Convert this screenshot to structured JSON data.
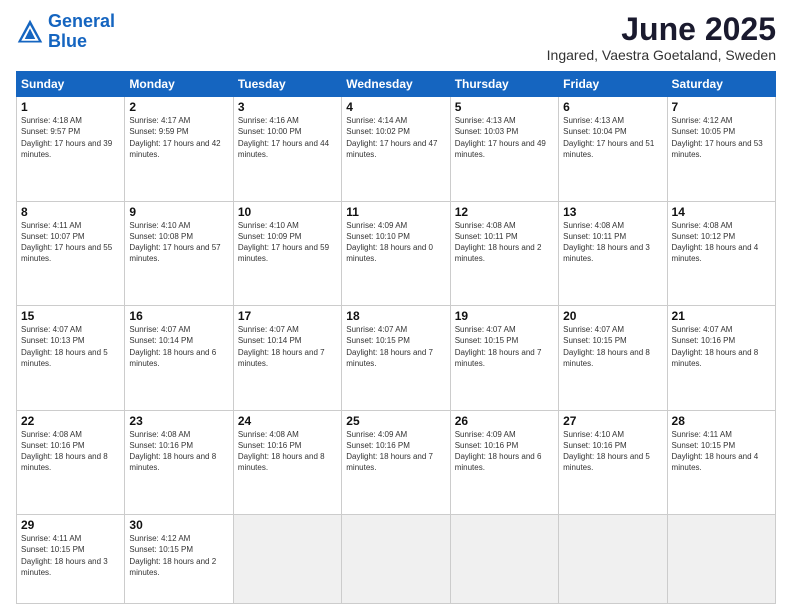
{
  "logo": {
    "line1": "General",
    "line2": "Blue"
  },
  "title": "June 2025",
  "subtitle": "Ingared, Vaestra Goetaland, Sweden",
  "weekdays": [
    "Sunday",
    "Monday",
    "Tuesday",
    "Wednesday",
    "Thursday",
    "Friday",
    "Saturday"
  ],
  "weeks": [
    [
      {
        "day": "1",
        "sunrise": "4:18 AM",
        "sunset": "9:57 PM",
        "daylight": "17 hours and 39 minutes."
      },
      {
        "day": "2",
        "sunrise": "4:17 AM",
        "sunset": "9:59 PM",
        "daylight": "17 hours and 42 minutes."
      },
      {
        "day": "3",
        "sunrise": "4:16 AM",
        "sunset": "10:00 PM",
        "daylight": "17 hours and 44 minutes."
      },
      {
        "day": "4",
        "sunrise": "4:14 AM",
        "sunset": "10:02 PM",
        "daylight": "17 hours and 47 minutes."
      },
      {
        "day": "5",
        "sunrise": "4:13 AM",
        "sunset": "10:03 PM",
        "daylight": "17 hours and 49 minutes."
      },
      {
        "day": "6",
        "sunrise": "4:13 AM",
        "sunset": "10:04 PM",
        "daylight": "17 hours and 51 minutes."
      },
      {
        "day": "7",
        "sunrise": "4:12 AM",
        "sunset": "10:05 PM",
        "daylight": "17 hours and 53 minutes."
      }
    ],
    [
      {
        "day": "8",
        "sunrise": "4:11 AM",
        "sunset": "10:07 PM",
        "daylight": "17 hours and 55 minutes."
      },
      {
        "day": "9",
        "sunrise": "4:10 AM",
        "sunset": "10:08 PM",
        "daylight": "17 hours and 57 minutes."
      },
      {
        "day": "10",
        "sunrise": "4:10 AM",
        "sunset": "10:09 PM",
        "daylight": "17 hours and 59 minutes."
      },
      {
        "day": "11",
        "sunrise": "4:09 AM",
        "sunset": "10:10 PM",
        "daylight": "18 hours and 0 minutes."
      },
      {
        "day": "12",
        "sunrise": "4:08 AM",
        "sunset": "10:11 PM",
        "daylight": "18 hours and 2 minutes."
      },
      {
        "day": "13",
        "sunrise": "4:08 AM",
        "sunset": "10:11 PM",
        "daylight": "18 hours and 3 minutes."
      },
      {
        "day": "14",
        "sunrise": "4:08 AM",
        "sunset": "10:12 PM",
        "daylight": "18 hours and 4 minutes."
      }
    ],
    [
      {
        "day": "15",
        "sunrise": "4:07 AM",
        "sunset": "10:13 PM",
        "daylight": "18 hours and 5 minutes."
      },
      {
        "day": "16",
        "sunrise": "4:07 AM",
        "sunset": "10:14 PM",
        "daylight": "18 hours and 6 minutes."
      },
      {
        "day": "17",
        "sunrise": "4:07 AM",
        "sunset": "10:14 PM",
        "daylight": "18 hours and 7 minutes."
      },
      {
        "day": "18",
        "sunrise": "4:07 AM",
        "sunset": "10:15 PM",
        "daylight": "18 hours and 7 minutes."
      },
      {
        "day": "19",
        "sunrise": "4:07 AM",
        "sunset": "10:15 PM",
        "daylight": "18 hours and 7 minutes."
      },
      {
        "day": "20",
        "sunrise": "4:07 AM",
        "sunset": "10:15 PM",
        "daylight": "18 hours and 8 minutes."
      },
      {
        "day": "21",
        "sunrise": "4:07 AM",
        "sunset": "10:16 PM",
        "daylight": "18 hours and 8 minutes."
      }
    ],
    [
      {
        "day": "22",
        "sunrise": "4:08 AM",
        "sunset": "10:16 PM",
        "daylight": "18 hours and 8 minutes."
      },
      {
        "day": "23",
        "sunrise": "4:08 AM",
        "sunset": "10:16 PM",
        "daylight": "18 hours and 8 minutes."
      },
      {
        "day": "24",
        "sunrise": "4:08 AM",
        "sunset": "10:16 PM",
        "daylight": "18 hours and 8 minutes."
      },
      {
        "day": "25",
        "sunrise": "4:09 AM",
        "sunset": "10:16 PM",
        "daylight": "18 hours and 7 minutes."
      },
      {
        "day": "26",
        "sunrise": "4:09 AM",
        "sunset": "10:16 PM",
        "daylight": "18 hours and 6 minutes."
      },
      {
        "day": "27",
        "sunrise": "4:10 AM",
        "sunset": "10:16 PM",
        "daylight": "18 hours and 5 minutes."
      },
      {
        "day": "28",
        "sunrise": "4:11 AM",
        "sunset": "10:15 PM",
        "daylight": "18 hours and 4 minutes."
      }
    ],
    [
      {
        "day": "29",
        "sunrise": "4:11 AM",
        "sunset": "10:15 PM",
        "daylight": "18 hours and 3 minutes."
      },
      {
        "day": "30",
        "sunrise": "4:12 AM",
        "sunset": "10:15 PM",
        "daylight": "18 hours and 2 minutes."
      },
      null,
      null,
      null,
      null,
      null
    ]
  ]
}
